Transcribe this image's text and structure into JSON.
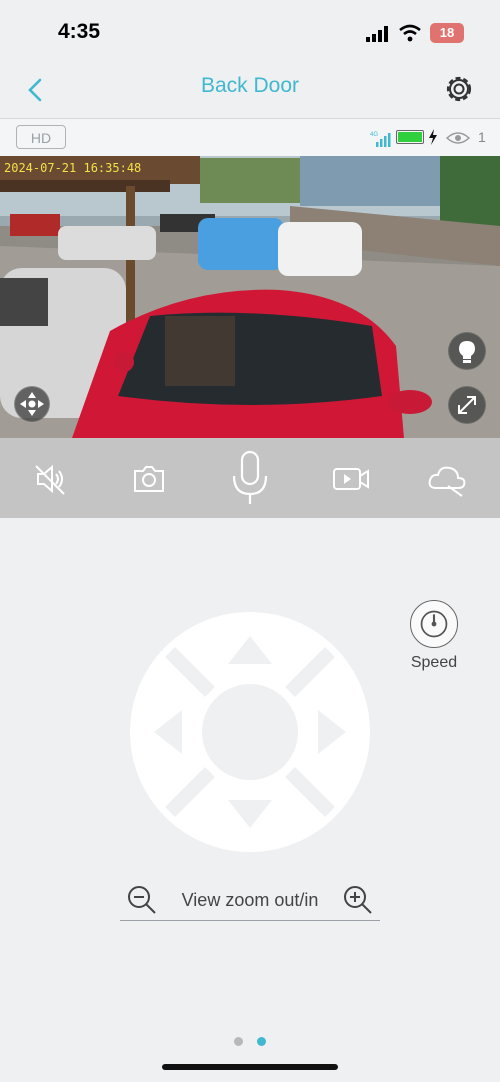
{
  "status": {
    "time": "4:35",
    "battery": "18"
  },
  "nav": {
    "title": "Back Door"
  },
  "camera": {
    "quality": "HD",
    "network": "4G",
    "battery_fill_percent": 100,
    "viewer_count": "1",
    "timestamp": "2024-07-21 16:35:48"
  },
  "controls": {
    "speed_label": "Speed",
    "zoom_label": "View zoom out/in"
  },
  "pager": {
    "pages": 2,
    "active_page": 2
  },
  "colors": {
    "accent": "#3fb8d0",
    "toolbar": "#c4c4c4",
    "battery_low": "#e0736f",
    "cam_battery": "#2fcf3e",
    "timestamp": "#f3e04a"
  }
}
